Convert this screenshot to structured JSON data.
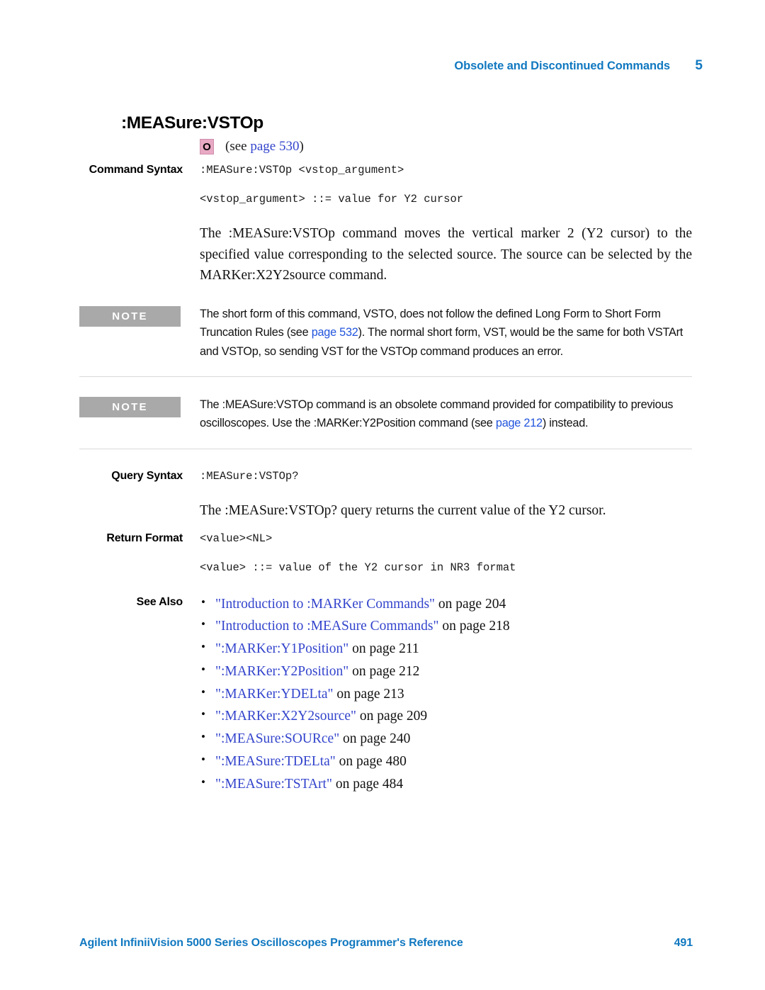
{
  "header": {
    "chapter_title": "Obsolete and Discontinued Commands",
    "chapter_number": "5"
  },
  "command": {
    "heading": ":MEASure:VSTOp",
    "obsolete_badge": "O",
    "see_prefix": "(see ",
    "see_link": "page  530",
    "see_suffix": ")"
  },
  "command_syntax": {
    "label": "Command Syntax",
    "line1": ":MEASure:VSTOp <vstop_argument>",
    "line2": "<vstop_argument> ::= value for Y2 cursor",
    "description": "The :MEASure:VSTOp command moves the vertical marker 2 (Y2 cursor) to the specified value corresponding to the selected source. The source can be selected by the MARKer:X2Y2source command."
  },
  "notes": [
    {
      "badge": "NOTE",
      "text_before_link": "The short form of this command, VSTO, does not follow the defined Long Form to Short Form Truncation Rules (see ",
      "link": "page 532",
      "text_after_link": "). The normal short form, VST, would be the same for both VSTArt and VSTOp, so sending VST for the VSTOp command produces an error."
    },
    {
      "badge": "NOTE",
      "text_before_link": "The :MEASure:VSTOp command is an obsolete command provided for compatibility to previous oscilloscopes. Use the :MARKer:Y2Position command (see ",
      "link": "page 212",
      "text_after_link": ") instead."
    }
  ],
  "query_syntax": {
    "label": "Query Syntax",
    "line1": ":MEASure:VSTOp?",
    "description": "The :MEASure:VSTOp? query returns the current value of the Y2 cursor."
  },
  "return_format": {
    "label": "Return Format",
    "line1": "<value><NL>",
    "line2": "<value> ::= value of the Y2 cursor in NR3 format"
  },
  "see_also": {
    "label": "See Also",
    "items": [
      {
        "link": "\"Introduction to :MARKer Commands\"",
        "page": " on page  204"
      },
      {
        "link": "\"Introduction to :MEASure Commands\"",
        "page": " on page  218"
      },
      {
        "link": "\":MARKer:Y1Position\"",
        "page": " on page  211"
      },
      {
        "link": "\":MARKer:Y2Position\"",
        "page": " on page  212"
      },
      {
        "link": "\":MARKer:YDELta\"",
        "page": " on page  213"
      },
      {
        "link": "\":MARKer:X2Y2source\"",
        "page": " on page  209"
      },
      {
        "link": "\":MEASure:SOURce\"",
        "page": " on page  240"
      },
      {
        "link": "\":MEASure:TDELta\"",
        "page": " on page  480"
      },
      {
        "link": "\":MEASure:TSTArt\"",
        "page": " on page  484"
      }
    ]
  },
  "footer": {
    "document_title": "Agilent InfiniiVision 5000 Series Oscilloscopes Programmer's Reference",
    "page_number": "491"
  },
  "colors": {
    "brand_blue": "#1078c0",
    "link_blue": "#3344cc",
    "note_link_blue": "#2255dd",
    "note_badge_gray": "#a9a9a9",
    "obsolete_badge_pink": "#e8a9c4"
  }
}
